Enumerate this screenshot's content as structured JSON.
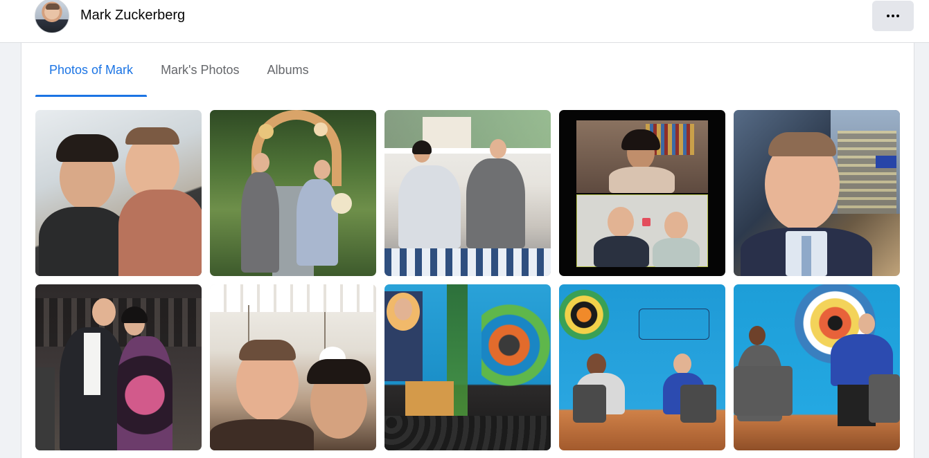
{
  "header": {
    "profile_name": "Mark Zuckerberg",
    "more_icon": "more-horizontal-icon"
  },
  "tabs": [
    {
      "label": "Photos of Mark",
      "active": true
    },
    {
      "label": "Mark's Photos",
      "active": false
    },
    {
      "label": "Albums",
      "active": false
    }
  ],
  "colors": {
    "accent": "#1b74e4",
    "tab_inactive": "#65676b",
    "page_bg": "#f0f2f5"
  },
  "photos": [
    {
      "alt": "couple selfie"
    },
    {
      "alt": "garden arch"
    },
    {
      "alt": "porch rocking chairs"
    },
    {
      "alt": "video call"
    },
    {
      "alt": "city selfie"
    },
    {
      "alt": "formal toast"
    },
    {
      "alt": "kitchen selfie"
    },
    {
      "alt": "summit stage with portrait"
    },
    {
      "alt": "black community summit"
    },
    {
      "alt": "stage conversation"
    }
  ]
}
